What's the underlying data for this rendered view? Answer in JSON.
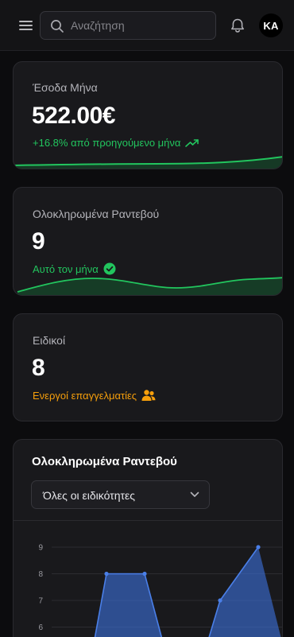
{
  "header": {
    "search_placeholder": "Αναζήτηση",
    "avatar_initials": "KA",
    "icons": [
      "menu-icon",
      "search-icon",
      "bell-icon"
    ]
  },
  "cards": {
    "income": {
      "label": "Έσοδα Μήνα",
      "value": "522.00€",
      "sub": "+16.8% από προηγούμενο μήνα",
      "sub_color": "#22c55e",
      "icon": "trending-up-icon"
    },
    "appointments": {
      "label": "Ολοκληρωμένα Ραντεβού",
      "value": "9",
      "sub": "Αυτό τον μήνα",
      "sub_color": "#22c55e",
      "icon": "check-circle-icon"
    },
    "specialists": {
      "label": "Ειδικοί",
      "value": "8",
      "sub": "Ενεργοί επαγγελματίες",
      "sub_color": "#f59e0b",
      "icon": "users-icon"
    }
  },
  "chart_section": {
    "title": "Ολοκληρωμένα Ραντεβού",
    "filter_value": "Όλες οι ειδικότητες"
  },
  "chart_data": {
    "type": "area",
    "y_ticks": [
      "9",
      "8",
      "7",
      "6"
    ],
    "visible_points": [
      {
        "y": 8
      },
      {
        "y": 8
      },
      {
        "y": 7
      },
      {
        "y": 9
      }
    ],
    "ylim_visible": [
      5.5,
      9
    ],
    "grid": true,
    "series_color": "#3b6fd8"
  }
}
